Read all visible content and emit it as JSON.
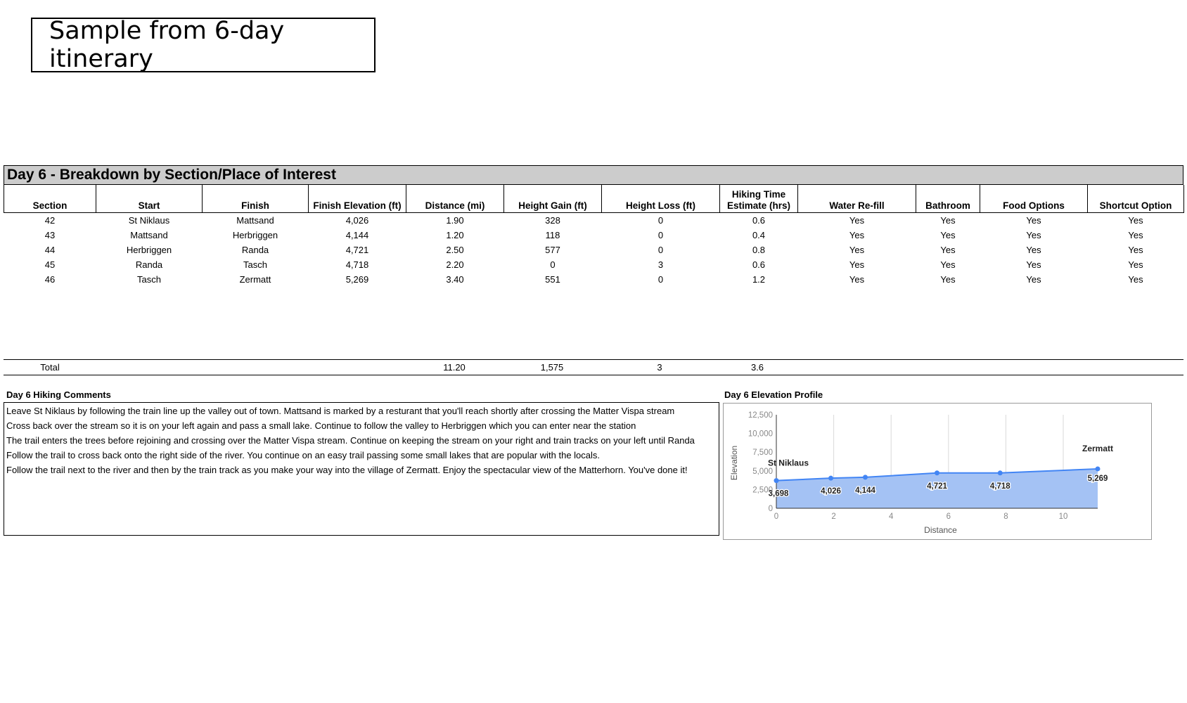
{
  "header": {
    "title": "Sample from 6-day itinerary"
  },
  "day": {
    "band_title": "Day 6 - Breakdown by Section/Place of Interest",
    "columns": [
      "Section",
      "Start",
      "Finish",
      "Finish Elevation (ft)",
      "Distance (mi)",
      "Height Gain (ft)",
      "Height Loss (ft)",
      "Hiking Time Estimate (hrs)",
      "Water Re-fill",
      "Bathroom",
      "Food Options",
      "Shortcut Option"
    ],
    "rows": [
      [
        "42",
        "St Niklaus",
        "Mattsand",
        "4,026",
        "1.90",
        "328",
        "0",
        "0.6",
        "Yes",
        "Yes",
        "Yes",
        "Yes"
      ],
      [
        "43",
        "Mattsand",
        "Herbriggen",
        "4,144",
        "1.20",
        "118",
        "0",
        "0.4",
        "Yes",
        "Yes",
        "Yes",
        "Yes"
      ],
      [
        "44",
        "Herbriggen",
        "Randa",
        "4,721",
        "2.50",
        "577",
        "0",
        "0.8",
        "Yes",
        "Yes",
        "Yes",
        "Yes"
      ],
      [
        "45",
        "Randa",
        "Tasch",
        "4,718",
        "2.20",
        "0",
        "3",
        "0.6",
        "Yes",
        "Yes",
        "Yes",
        "Yes"
      ],
      [
        "46",
        "Tasch",
        "Zermatt",
        "5,269",
        "3.40",
        "551",
        "0",
        "1.2",
        "Yes",
        "Yes",
        "Yes",
        "Yes"
      ]
    ],
    "total": {
      "label": "Total",
      "distance": "11.20",
      "gain": "1,575",
      "loss": "3",
      "time": "3.6"
    }
  },
  "comments": {
    "label": "Day 6 Hiking Comments",
    "lines": [
      "Leave St Niklaus by following the train line up the valley out of town. Mattsand is marked by a resturant that you'll reach shortly after crossing the Matter Vispa stream",
      "Cross back over the stream so it is on your left again and pass a small lake. Continue to follow the valley to Herbriggen which you can enter near the station",
      "The trail enters the trees before rejoining and crossing over the Matter Vispa stream. Continue on keeping the stream on your right and train tracks on your left until Randa",
      "Follow the trail to cross back onto the right side of the river. You continue on an easy trail passing some small lakes that are popular with the locals.",
      "Follow the trail next to the river and then by the train track as you make your way into the village of Zermatt. Enjoy the spectacular view of the Matterhorn. You've done it!"
    ]
  },
  "chart_label": "Day 6 Elevation Profile",
  "chart_data": {
    "type": "area",
    "xlabel": "Distance",
    "ylabel": "Elevation",
    "xlim": [
      0,
      11.2
    ],
    "ylim": [
      0,
      12500
    ],
    "x_ticks": [
      0,
      2,
      4,
      6,
      8,
      10
    ],
    "y_ticks": [
      0,
      2500,
      5000,
      7500,
      10000,
      12500
    ],
    "y_tick_labels": [
      "0",
      "2,500",
      "5,000",
      "7,500",
      "10,000",
      "12,500"
    ],
    "x": [
      0,
      1.9,
      3.1,
      5.6,
      7.8,
      11.2
    ],
    "y": [
      3698,
      4026,
      4144,
      4721,
      4718,
      5269
    ],
    "data_labels": [
      "3,698",
      "4,026",
      "4,144",
      "4,721",
      "4,718",
      "5,269"
    ],
    "annotations": [
      {
        "text": "St Niklaus",
        "x": 0
      },
      {
        "text": "Zermatt",
        "x": 11.2
      }
    ],
    "color": "#4285f4",
    "fill": "#a4c2f4",
    "grid": true
  }
}
